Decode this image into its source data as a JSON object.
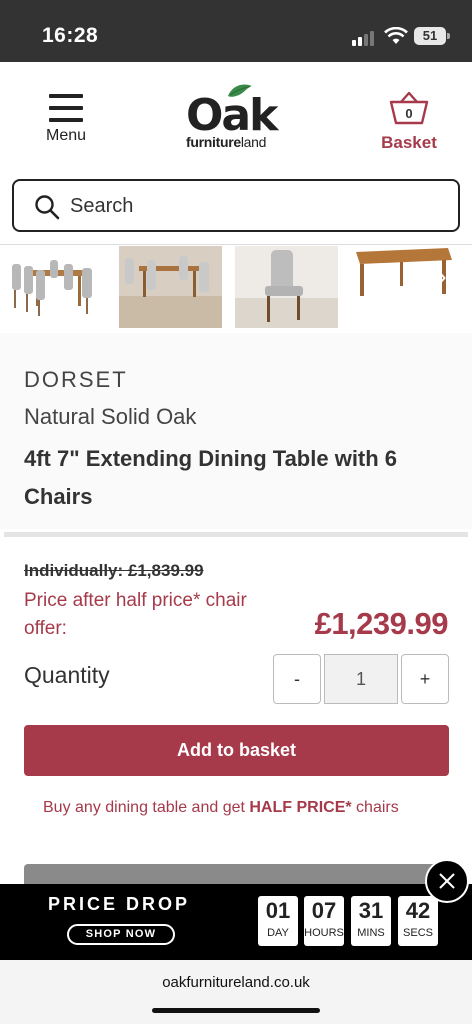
{
  "status_bar": {
    "time": "16:28",
    "battery": "51"
  },
  "header": {
    "menu_label": "Menu",
    "logo_main": "Oak",
    "logo_sub_bold": "furniture",
    "logo_sub_rest": "land",
    "basket_label": "Basket",
    "basket_count": "0"
  },
  "search": {
    "placeholder": "Search"
  },
  "gallery": {
    "thumbnails": [
      "dining-set-front",
      "dining-set-room",
      "chair-side",
      "table-extended"
    ]
  },
  "product": {
    "brand": "DORSET",
    "material": "Natural Solid Oak",
    "name": "4ft 7\" Extending Dining Table with 6 Chairs"
  },
  "pricing": {
    "old_price": "Individually: £1,839.99",
    "offer_label": "Price after half price* chair offer:",
    "price": "£1,239.99",
    "quantity_label": "Quantity",
    "minus": "-",
    "quantity_value": "1",
    "plus": "+",
    "add_to_basket": "Add to basket",
    "promo_prefix": "Buy any dining table and get ",
    "promo_bold": "HALF PRICE*",
    "promo_suffix": " chairs"
  },
  "banner": {
    "title": "PRICE DROP",
    "shop_now": "SHOP NOW",
    "countdown": [
      {
        "value": "01",
        "unit": "DAY"
      },
      {
        "value": "07",
        "unit": "HOURS"
      },
      {
        "value": "31",
        "unit": "MINS"
      },
      {
        "value": "42",
        "unit": "SECS"
      }
    ]
  },
  "browser": {
    "url": "oakfurnitureland.co.uk"
  },
  "colors": {
    "brand_red": "#a63a4a",
    "dark": "#333333",
    "banner_bg": "#000000"
  }
}
